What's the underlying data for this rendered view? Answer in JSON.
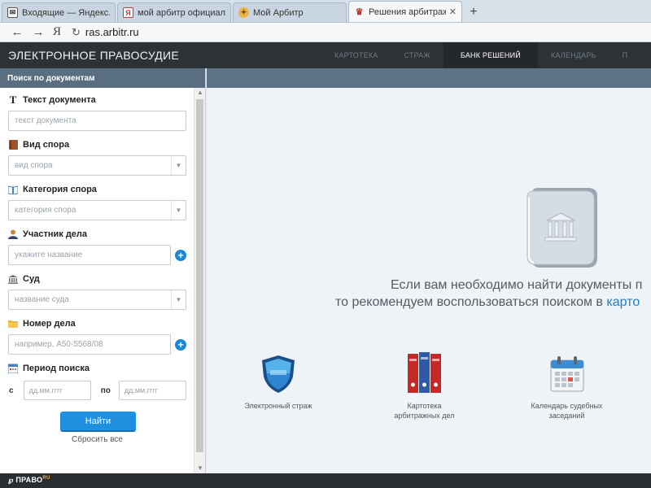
{
  "browser": {
    "tabs": [
      {
        "label": "Входящие — Яндекс.П",
        "active": false
      },
      {
        "label": "мой арбитр официал",
        "active": false
      },
      {
        "label": "Мой Арбитр",
        "active": false
      },
      {
        "label": "Решения арбитражны",
        "active": true
      }
    ],
    "new_tab": "+",
    "url": "ras.arbitr.ru",
    "ya_label": "Я"
  },
  "site": {
    "brand": "ЭЛЕКТРОННОЕ ПРАВОСУДИЕ",
    "nav": [
      {
        "label": "КАРТОТЕКА",
        "active": false
      },
      {
        "label": "СТРАЖ",
        "active": false
      },
      {
        "label": "БАНК РЕШЕНИЙ",
        "active": true
      },
      {
        "label": "КАЛЕНДАРЬ",
        "active": false
      },
      {
        "label": "П",
        "active": false
      }
    ]
  },
  "sidebar": {
    "title": "Поиск по документам",
    "doc_text": {
      "label": "Текст документа",
      "placeholder": "текст документа"
    },
    "dispute_type": {
      "label": "Вид спора",
      "placeholder": "вид спора"
    },
    "dispute_category": {
      "label": "Категория спора",
      "placeholder": "категория спора"
    },
    "participant": {
      "label": "Участник дела",
      "placeholder": "укажите название"
    },
    "court": {
      "label": "Суд",
      "placeholder": "название суда"
    },
    "case_number": {
      "label": "Номер дела",
      "placeholder": "например, А50-5568/08"
    },
    "period": {
      "label": "Период поиска",
      "from_label": "с",
      "to_label": "по",
      "from_placeholder": "дд.мм.гггг",
      "to_placeholder": "дд.мм.гггг"
    },
    "find_button": "Найти",
    "reset_link": "Сбросить все"
  },
  "main": {
    "promo_line1": "Если вам необходимо найти документы п",
    "promo_line2_text": "то рекомендуем воспользоваться поиском в ",
    "promo_line2_link": "карто",
    "tiles": [
      {
        "label": "Электронный страж",
        "icon": "shield-icon"
      },
      {
        "label": "Картотека арбитражных дел",
        "icon": "binders-icon"
      },
      {
        "label": "Календарь судебных заседаний",
        "icon": "calendar-icon"
      }
    ]
  },
  "footer": {
    "logo_mark": "℘",
    "logo_text": "ПРАВО",
    "logo_suffix": "RU"
  },
  "colors": {
    "accent": "#1f8fe0",
    "header_bg": "#2d3236",
    "sidebar_title_bg": "#5a6e82",
    "link": "#1a7fcc"
  }
}
